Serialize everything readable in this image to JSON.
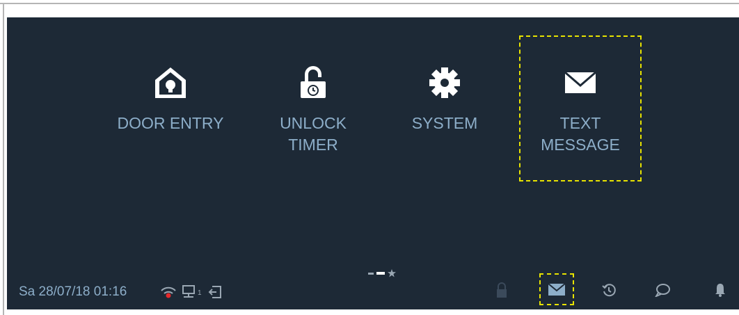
{
  "tiles": [
    {
      "label": "DOOR ENTRY",
      "icon": "home-bulb-icon"
    },
    {
      "label": "UNLOCK\nTIMER",
      "icon": "padlock-timer-icon"
    },
    {
      "label": "SYSTEM",
      "icon": "gear-icon"
    },
    {
      "label": "TEXT\nMESSAGE",
      "icon": "envelope-icon"
    }
  ],
  "page_indicator": {
    "pages": 3,
    "current_page": 2
  },
  "status_bar": {
    "datetime": "Sa 28/07/18  01:16",
    "icons": [
      "wifi-icon",
      "network-icon",
      "exit-icon"
    ],
    "network_index": "1"
  },
  "bottom_bar": {
    "icons": [
      "lock-icon",
      "message-icon",
      "history-icon",
      "chat-icon",
      "bell-icon"
    ]
  },
  "colors": {
    "background": "#1d2936",
    "text": "#8daec9",
    "focus": "#e8e300",
    "alert": "#e5282a"
  }
}
